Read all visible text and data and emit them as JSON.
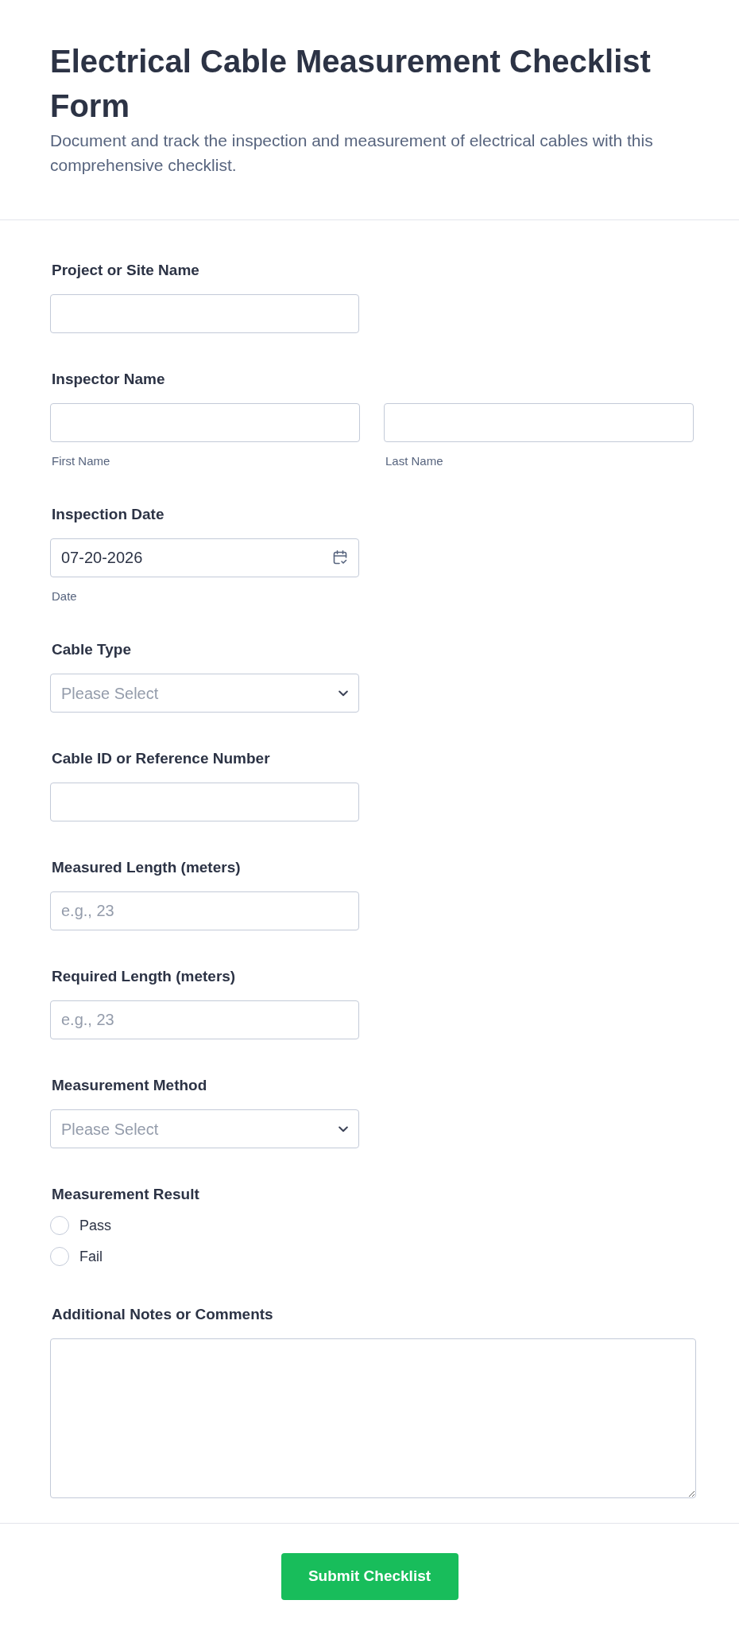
{
  "header": {
    "title": "Electrical Cable Measurement Checklist Form",
    "description": "Document and track the inspection and measurement of electrical cables with this comprehensive checklist."
  },
  "fields": [
    {
      "kind": "text",
      "label": "Project or Site Name"
    },
    {
      "kind": "name",
      "label": "Inspector Name",
      "parts": [
        {
          "sublabel": "First Name"
        },
        {
          "sublabel": "Last Name"
        }
      ]
    },
    {
      "kind": "date",
      "label": "Inspection Date",
      "value": "07-20-2026",
      "sublabel": "Date"
    },
    {
      "kind": "select",
      "label": "Cable Type",
      "placeholder": "Please Select"
    },
    {
      "kind": "text",
      "label": "Cable ID or Reference Number"
    },
    {
      "kind": "text",
      "label": "Measured Length (meters)",
      "placeholder": "e.g., 23"
    },
    {
      "kind": "text",
      "label": "Required Length (meters)",
      "placeholder": "e.g., 23"
    },
    {
      "kind": "select",
      "label": "Measurement Method",
      "placeholder": "Please Select"
    },
    {
      "kind": "radio",
      "label": "Measurement Result",
      "options": [
        {
          "label": "Pass",
          "selected": false
        },
        {
          "label": "Fail",
          "selected": false
        }
      ]
    },
    {
      "kind": "textarea",
      "label": "Additional Notes or Comments"
    }
  ],
  "submit_button": {
    "label": "Submit Checklist"
  }
}
